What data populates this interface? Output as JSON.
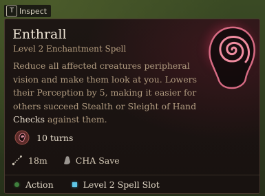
{
  "inspect": {
    "key": "T",
    "label": "Inspect"
  },
  "spell": {
    "name": "Enthrall",
    "subtitle": "Level 2 Enchantment Spell",
    "description_before": "Reduce all affected creatures peripheral vision and make them look at you. Lowers their Perception by 5, making it easier for others succeed Stealth or Sleight of Hand ",
    "description_highlight": "Checks",
    "description_after": " against them.",
    "duration": "10 turns",
    "range": "18m",
    "save": "CHA Save",
    "cost_action": "Action",
    "cost_slot": "Level 2 Spell Slot",
    "icon": "enthrall-spiral-head-icon"
  },
  "colors": {
    "title": "#efe6d6",
    "subtitle": "#b79f80",
    "action_dot": "#3f7f3d",
    "spell_slot": "#5fc7e8",
    "icon_glow": "#e0708a"
  }
}
